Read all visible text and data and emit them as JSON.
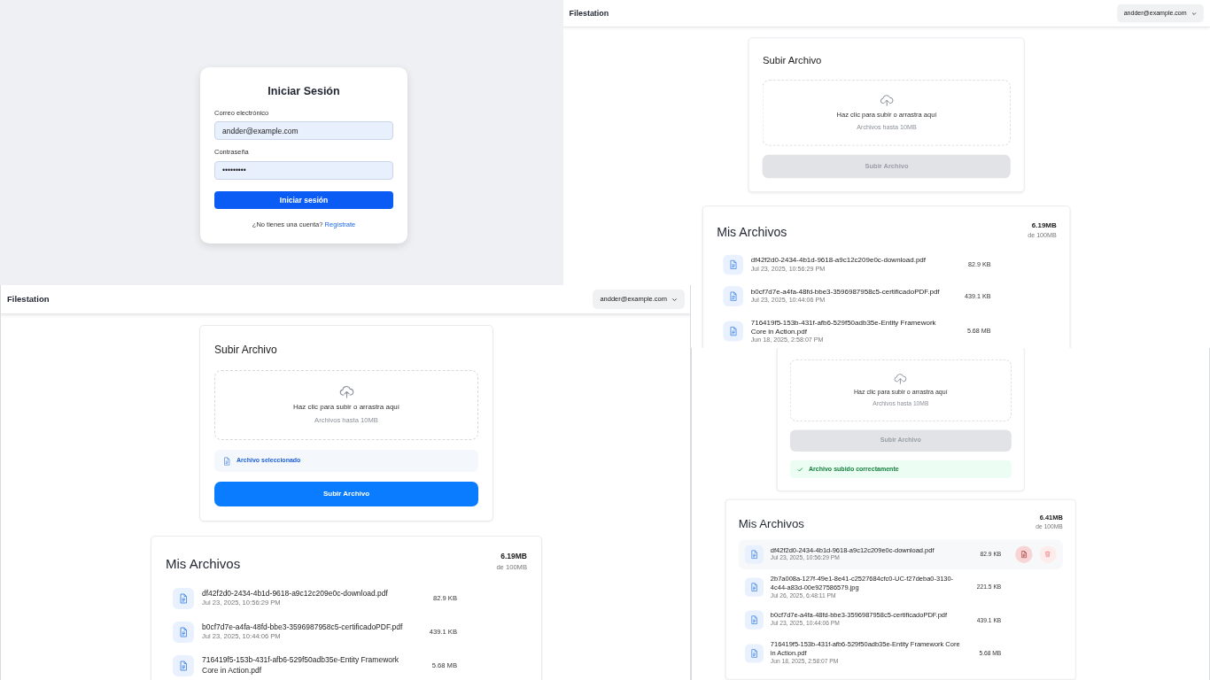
{
  "panels": [
    {
      "kind": "login",
      "title": "Iniciar Sesión",
      "fields": [
        {
          "label": "Correo electrónico",
          "value": "andder@example.com"
        },
        {
          "label": "Contraseña",
          "value": "•••••••••"
        }
      ],
      "submit": "Iniciar sesión",
      "prompt": "¿No tienes una cuenta?",
      "link": "Regístrate"
    },
    {
      "kind": "app",
      "navbar": {
        "brand": "Filestation",
        "user": "andder@example.com"
      },
      "upload": {
        "title": "Subir Archivo",
        "drop_text": "Haz clic para subir o arrastra aquí",
        "drop_hint": "Archivos hasta 10MB",
        "button": {
          "label": "Subir Archivo",
          "disabled": true
        }
      },
      "files": {
        "title": "Mis Archivos",
        "used": "6.19MB",
        "quota": "de 100MB",
        "items": [
          {
            "name": "df42f2d0-2434-4b1d-9618-a9c12c209e0c-download.pdf",
            "date": "Jul 23, 2025, 10:56:29 PM",
            "size": "82.9 KB",
            "highlighted": false
          },
          {
            "name": "b0cf7d7e-a4fa-48fd-bbe3-3596987958c5-certificadoPDF.pdf",
            "date": "Jul 23, 2025, 10:44:06 PM",
            "size": "439.1 KB",
            "highlighted": false
          },
          {
            "name": "716419f5-153b-431f-afb6-529f50adb35e-Entity Framework Core in Action.pdf",
            "date": "Jun 18, 2025, 2:58:07 PM",
            "size": "5.68 MB",
            "highlighted": false
          }
        ]
      }
    },
    {
      "kind": "app",
      "navbar": {
        "brand": "Filestation",
        "user": "andder@example.com"
      },
      "upload": {
        "title": "Subir Archivo",
        "drop_text": "Haz clic para subir o arrastra aquí",
        "drop_hint": "Archivos hasta 10MB",
        "selected_file": "Archivo seleccionado",
        "button": {
          "label": "Subir Archivo",
          "disabled": false
        }
      },
      "files": {
        "title": "Mis Archivos",
        "used": "6.19MB",
        "quota": "de 100MB",
        "items": [
          {
            "name": "df42f2d0-2434-4b1d-9618-a9c12c209e0c-download.pdf",
            "date": "Jul 23, 2025, 10:56:29 PM",
            "size": "82.9 KB",
            "highlighted": false
          },
          {
            "name": "b0cf7d7e-a4fa-48fd-bbe3-3596987958c5-certificadoPDF.pdf",
            "date": "Jul 23, 2025, 10:44:06 PM",
            "size": "439.1 KB",
            "highlighted": false
          },
          {
            "name": "716419f5-153b-431f-afb6-529f50adb35e-Entity Framework Core in Action.pdf",
            "size": "5.68 MB",
            "highlighted": false
          }
        ]
      }
    },
    {
      "kind": "app",
      "upload": {
        "drop_text": "Haz clic para subir o arrastra aquí",
        "drop_hint": "Archivos hasta 10MB",
        "button": {
          "label": "Subir Archivo",
          "disabled": true
        },
        "success": "Archivo subido correctamente"
      },
      "files": {
        "title": "Mis Archivos",
        "used": "6.41MB",
        "quota": "de 100MB",
        "items": [
          {
            "name": "df42f2d0-2434-4b1d-9618-a9c12c209e0c-download.pdf",
            "date": "Jul 23, 2025, 10:56:29 PM",
            "size": "82.9 KB",
            "highlighted": true
          },
          {
            "name": "2b7a008a-127f-49e1-8e41-c2527684cfc0-UC-f27deba0-3130-4c44-a83d-00e927586579.jpg",
            "date": "Jul 26, 2025, 6:48:11 PM",
            "size": "221.5 KB",
            "highlighted": false
          },
          {
            "name": "b0cf7d7e-a4fa-48fd-bbe3-3596987958c5-certificadoPDF.pdf",
            "date": "Jul 23, 2025, 10:44:06 PM",
            "size": "439.1 KB",
            "highlighted": false
          },
          {
            "name": "716419f5-153b-431f-afb6-529f50adb35e-Entity Framework Core in Action.pdf",
            "date": "Jun 18, 2025, 2:58:07 PM",
            "size": "5.68 MB",
            "highlighted": false
          }
        ]
      }
    }
  ]
}
